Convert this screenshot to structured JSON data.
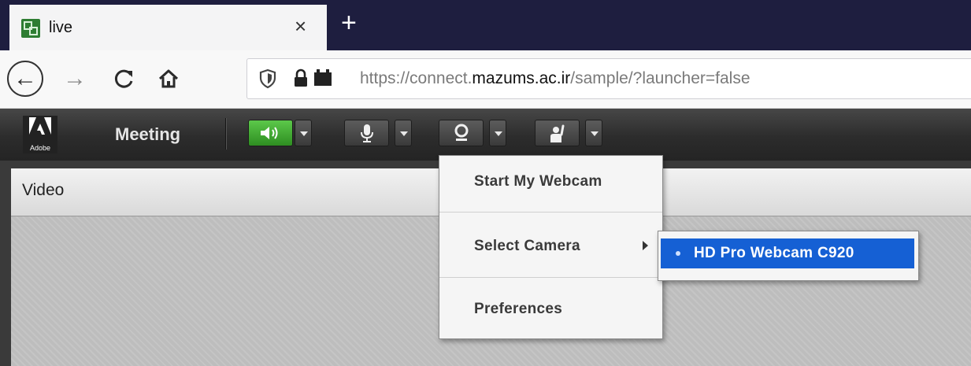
{
  "browser": {
    "tab": {
      "title": "live",
      "close_glyph": "×",
      "favicon": "app-grid-icon"
    },
    "new_tab_glyph": "+",
    "nav": {
      "back_glyph": "←",
      "forward_glyph": "→",
      "reload_glyph": "C"
    },
    "address": {
      "prefix": "https://connect.",
      "host": "mazums.ac.ir",
      "path": "/sample/?launcher=false"
    }
  },
  "app": {
    "logo_text": "Adobe",
    "menu_meeting": "Meeting",
    "toolbar": {
      "speaker": {
        "icon": "speaker-icon",
        "active": true,
        "color": "#3dbb2f"
      },
      "microphone": {
        "icon": "microphone-icon"
      },
      "webcam": {
        "icon": "webcam-icon"
      },
      "raise_hand": {
        "icon": "raise-hand-icon"
      }
    }
  },
  "pod": {
    "title": "Video"
  },
  "webcam_menu": {
    "items": [
      {
        "label": "Start My Webcam"
      },
      {
        "label": "Select Camera",
        "has_submenu": true
      },
      {
        "label": "Preferences"
      }
    ],
    "submenu": {
      "selected_camera": "HD Pro Webcam C920",
      "highlight_color": "#1560d4"
    }
  }
}
